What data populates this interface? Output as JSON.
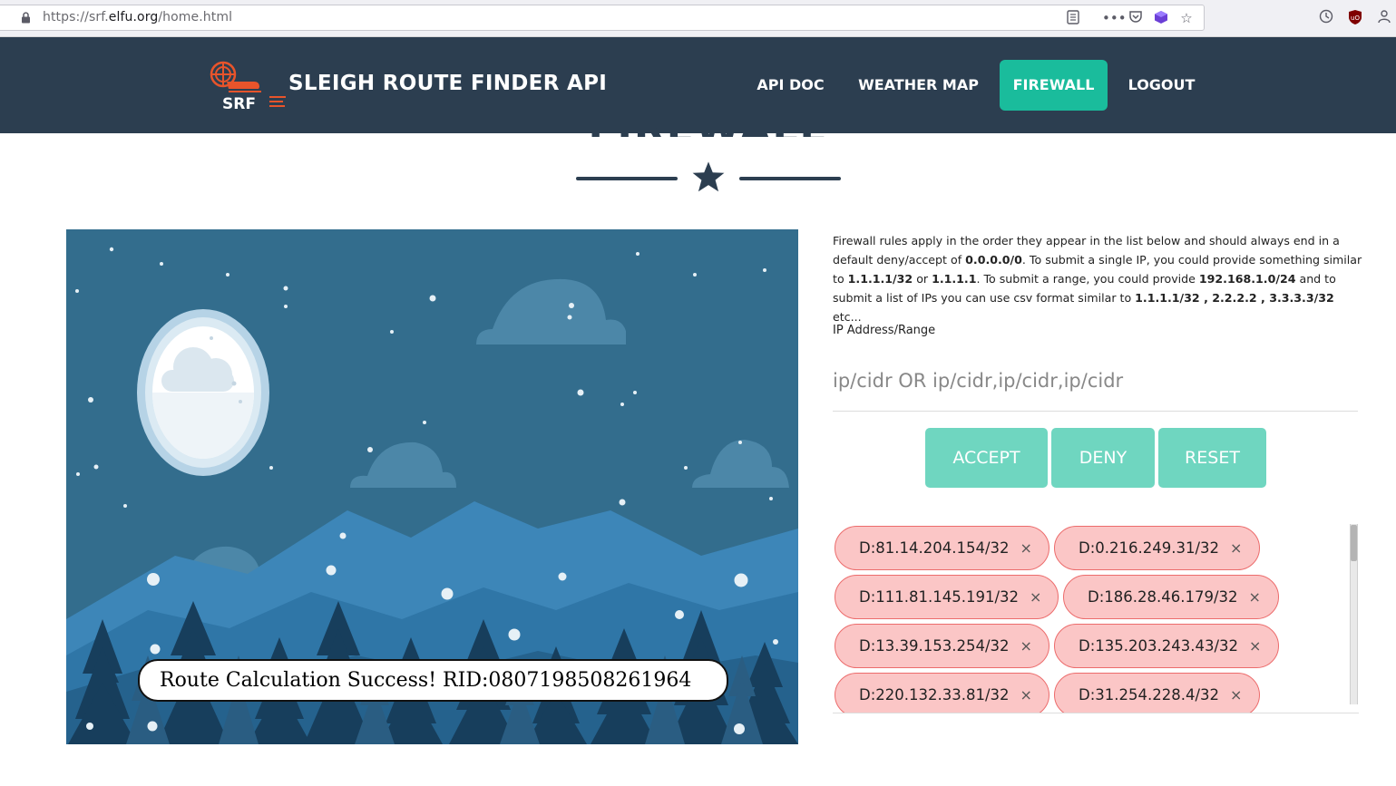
{
  "browser": {
    "url_prefix": "https://srf.",
    "url_domain": "elfu.org",
    "url_suffix": "/home.html"
  },
  "nav": {
    "brand": "SLEIGH ROUTE FINDER API",
    "logo_text": "SRF",
    "links": [
      {
        "label": "API DOC"
      },
      {
        "label": "WEATHER MAP"
      },
      {
        "label": "FIREWALL"
      },
      {
        "label": "LOGOUT"
      }
    ],
    "accent_color": "#1abc9c",
    "bg_color": "#2c3e50"
  },
  "section": {
    "title": "FIREWALL"
  },
  "toast": {
    "message": "Route Calculation Success! RID:0807198508261964"
  },
  "firewall": {
    "desc_1": "Firewall rules apply in the order they appear in the list below and should always end in a default deny/accept of ",
    "desc_b1": "0.0.0.0/0",
    "desc_2": ". To submit a single IP, you could provide something similar to ",
    "desc_b2": "1.1.1.1/32",
    "desc_3": " or ",
    "desc_b3": "1.1.1.1",
    "desc_4": ". To submit a range, you could provide ",
    "desc_b4": "192.168.1.0/24",
    "desc_5": " and to submit a list of IPs you can use csv format similar to ",
    "desc_b5": "1.1.1.1/32 , 2.2.2.2 , 3.3.3.3/32",
    "desc_6": " etc...",
    "ip_label": "IP Address/Range",
    "ip_placeholder": "ip/cidr OR ip/cidr,ip/cidr,ip/cidr",
    "buttons": {
      "accept": "ACCEPT",
      "deny": "DENY",
      "reset": "RESET"
    },
    "rules": [
      {
        "text": "D:81.14.204.154/32",
        "remove": "×"
      },
      {
        "text": "D:0.216.249.31/32",
        "remove": "×"
      },
      {
        "text": "D:111.81.145.191/32",
        "remove": "×"
      },
      {
        "text": "D:186.28.46.179/32",
        "remove": "×"
      },
      {
        "text": "D:13.39.153.254/32",
        "remove": "×"
      },
      {
        "text": "D:135.203.243.43/32",
        "remove": "×"
      },
      {
        "text": "D:220.132.33.81/32",
        "remove": "×"
      },
      {
        "text": "D:31.254.228.4/32",
        "remove": "×"
      }
    ]
  }
}
